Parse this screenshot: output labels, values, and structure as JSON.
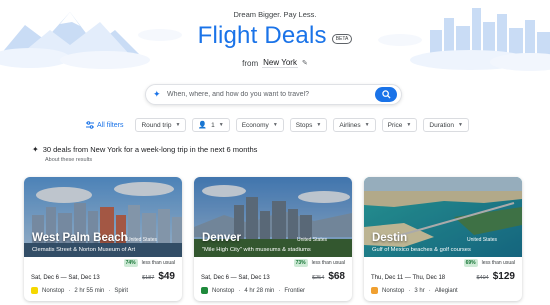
{
  "header": {
    "tagline": "Dream Bigger. Pay Less.",
    "title": "Flight Deals",
    "beta": "BETA",
    "from_label": "from",
    "from_city": "New York"
  },
  "search": {
    "placeholder": "When, where, and how do you want to travel?"
  },
  "filters": {
    "all_filters": "All filters",
    "chips": [
      "Round trip",
      "1",
      "Economy",
      "Stops",
      "Airlines",
      "Price",
      "Duration"
    ]
  },
  "results": {
    "summary": "30 deals from New York for a week-long trip in the next 6 months",
    "about": "About these results"
  },
  "deals": [
    {
      "city": "West Palm Beach",
      "country": "United States",
      "description": "Clematis Street & Norton Museum of Art",
      "discount": "74%",
      "discount_text": "less than usual",
      "dates": "Sat, Dec 6 — Sat, Dec 13",
      "old_price": "$187",
      "price": "$49",
      "stops": "Nonstop",
      "duration": "2 hr 55 min",
      "airline": "Spirit",
      "airline_color": "#f5d800"
    },
    {
      "city": "Denver",
      "country": "United States",
      "description": "\"Mile High City\" with museums & stadiums",
      "discount": "73%",
      "discount_text": "less than usual",
      "dates": "Sat, Dec 6 — Sat, Dec 13",
      "old_price": "$254",
      "price": "$68",
      "stops": "Nonstop",
      "duration": "4 hr 28 min",
      "airline": "Frontier",
      "airline_color": "#1f8a3c"
    },
    {
      "city": "Destin",
      "country": "United States",
      "description": "Gulf of Mexico beaches & golf courses",
      "discount": "69%",
      "discount_text": "less than usual",
      "dates": "Thu, Dec 11 — Thu, Dec 18",
      "old_price": "$404",
      "price": "$129",
      "stops": "Nonstop",
      "duration": "3 hr",
      "airline": "Allegiant",
      "airline_color": "#f0a030"
    }
  ]
}
